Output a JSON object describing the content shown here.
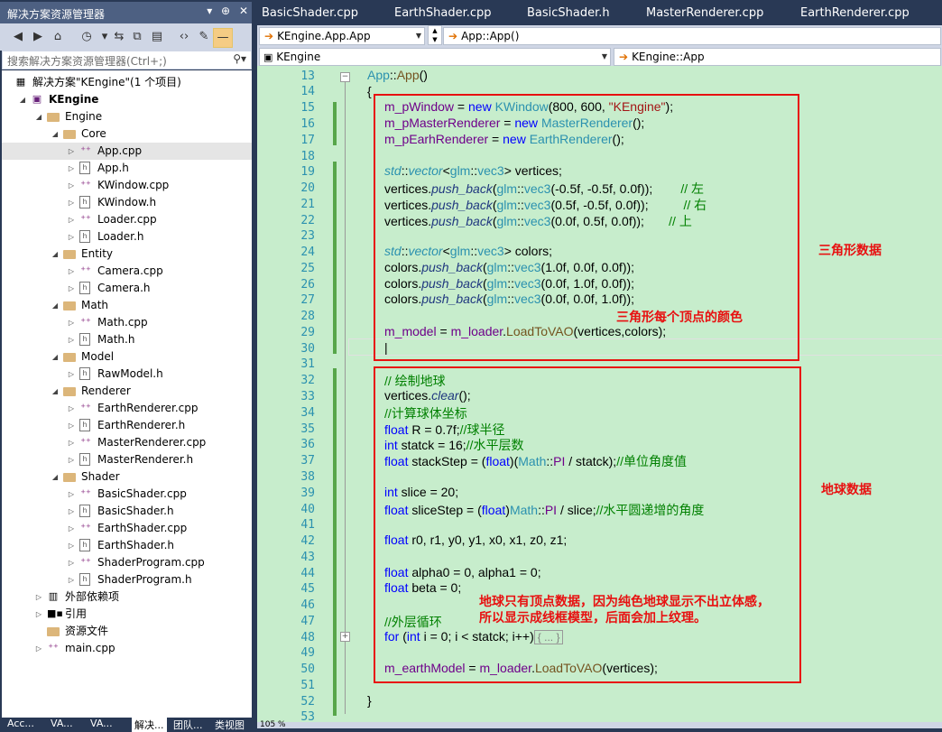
{
  "solution_explorer": {
    "title": "解决方案资源管理器",
    "title_buttons": [
      "▾",
      "⊕",
      "✕"
    ],
    "search_placeholder": "搜索解决方案资源管理器(Ctrl+;)",
    "tree": [
      {
        "label": "解决方案\"KEngine\"(1 个项目)",
        "level": 0,
        "icon": "solution-icon",
        "arrow": "",
        "selected": false
      },
      {
        "label": "KEngine",
        "level": 1,
        "icon": "project-icon",
        "arrow": "expanded",
        "selected": false,
        "bold": true
      },
      {
        "label": "Engine",
        "level": 2,
        "icon": "folder-icon",
        "arrow": "expanded",
        "selected": false
      },
      {
        "label": "Core",
        "level": 3,
        "icon": "folder-icon",
        "arrow": "expanded",
        "selected": false
      },
      {
        "label": "App.cpp",
        "level": 4,
        "icon": "cpp-file-icon",
        "arrow": "collapsed",
        "selected": true
      },
      {
        "label": "App.h",
        "level": 4,
        "icon": "header-file-icon",
        "arrow": "collapsed",
        "selected": false
      },
      {
        "label": "KWindow.cpp",
        "level": 4,
        "icon": "cpp-file-icon",
        "arrow": "collapsed",
        "selected": false
      },
      {
        "label": "KWindow.h",
        "level": 4,
        "icon": "header-file-icon",
        "arrow": "collapsed",
        "selected": false
      },
      {
        "label": "Loader.cpp",
        "level": 4,
        "icon": "cpp-file-icon",
        "arrow": "collapsed",
        "selected": false
      },
      {
        "label": "Loader.h",
        "level": 4,
        "icon": "header-file-icon",
        "arrow": "collapsed",
        "selected": false
      },
      {
        "label": "Entity",
        "level": 3,
        "icon": "folder-icon",
        "arrow": "expanded",
        "selected": false
      },
      {
        "label": "Camera.cpp",
        "level": 4,
        "icon": "cpp-file-icon",
        "arrow": "collapsed",
        "selected": false
      },
      {
        "label": "Camera.h",
        "level": 4,
        "icon": "header-file-icon",
        "arrow": "collapsed",
        "selected": false
      },
      {
        "label": "Math",
        "level": 3,
        "icon": "folder-icon",
        "arrow": "expanded",
        "selected": false
      },
      {
        "label": "Math.cpp",
        "level": 4,
        "icon": "cpp-file-icon",
        "arrow": "collapsed",
        "selected": false
      },
      {
        "label": "Math.h",
        "level": 4,
        "icon": "header-file-icon",
        "arrow": "collapsed",
        "selected": false
      },
      {
        "label": "Model",
        "level": 3,
        "icon": "folder-icon",
        "arrow": "expanded",
        "selected": false
      },
      {
        "label": "RawModel.h",
        "level": 4,
        "icon": "header-file-icon",
        "arrow": "collapsed",
        "selected": false
      },
      {
        "label": "Renderer",
        "level": 3,
        "icon": "folder-icon",
        "arrow": "expanded",
        "selected": false
      },
      {
        "label": "EarthRenderer.cpp",
        "level": 4,
        "icon": "cpp-file-icon",
        "arrow": "collapsed",
        "selected": false
      },
      {
        "label": "EarthRenderer.h",
        "level": 4,
        "icon": "header-file-icon",
        "arrow": "collapsed",
        "selected": false
      },
      {
        "label": "MasterRenderer.cpp",
        "level": 4,
        "icon": "cpp-file-icon",
        "arrow": "collapsed",
        "selected": false
      },
      {
        "label": "MasterRenderer.h",
        "level": 4,
        "icon": "header-file-icon",
        "arrow": "collapsed",
        "selected": false
      },
      {
        "label": "Shader",
        "level": 3,
        "icon": "folder-icon",
        "arrow": "expanded",
        "selected": false
      },
      {
        "label": "BasicShader.cpp",
        "level": 4,
        "icon": "cpp-file-icon",
        "arrow": "collapsed",
        "selected": false
      },
      {
        "label": "BasicShader.h",
        "level": 4,
        "icon": "header-file-icon",
        "arrow": "collapsed",
        "selected": false
      },
      {
        "label": "EarthShader.cpp",
        "level": 4,
        "icon": "cpp-file-icon",
        "arrow": "collapsed",
        "selected": false
      },
      {
        "label": "EarthShader.h",
        "level": 4,
        "icon": "header-file-icon",
        "arrow": "collapsed",
        "selected": false
      },
      {
        "label": "ShaderProgram.cpp",
        "level": 4,
        "icon": "cpp-file-icon",
        "arrow": "collapsed",
        "selected": false
      },
      {
        "label": "ShaderProgram.h",
        "level": 4,
        "icon": "header-file-icon",
        "arrow": "collapsed",
        "selected": false
      },
      {
        "label": "外部依赖项",
        "level": 2,
        "icon": "dependencies-icon",
        "arrow": "collapsed",
        "selected": false
      },
      {
        "label": "引用",
        "level": 2,
        "icon": "references-icon",
        "arrow": "collapsed",
        "selected": false
      },
      {
        "label": "资源文件",
        "level": 2,
        "icon": "folder-icon",
        "arrow": "",
        "selected": false
      },
      {
        "label": "main.cpp",
        "level": 2,
        "icon": "cpp-file-icon",
        "arrow": "collapsed",
        "selected": false
      }
    ],
    "bottom_tabs": [
      "Acc...",
      "VA...",
      "VA...",
      "解决...",
      "团队...",
      "类视图"
    ]
  },
  "editor": {
    "tabs": [
      "BasicShader.cpp",
      "EarthShader.cpp",
      "BasicShader.h",
      "MasterRenderer.cpp",
      "EarthRenderer.cpp"
    ],
    "nav_scope": "KEngine.App.App",
    "nav_member": "App::App()",
    "nav_project": "KEngine",
    "nav_class": "KEngine::App",
    "zoom": "105 %",
    "annotations": {
      "triangle_data": "三角形数据",
      "vertex_color": "三角形每个顶点的颜色",
      "earth_data": "地球数据",
      "earth_note_1": "地球只有顶点数据，因为纯色地球显示不出立体感，",
      "earth_note_2": "所以显示成线框模型，后面会加上纹理。"
    }
  }
}
